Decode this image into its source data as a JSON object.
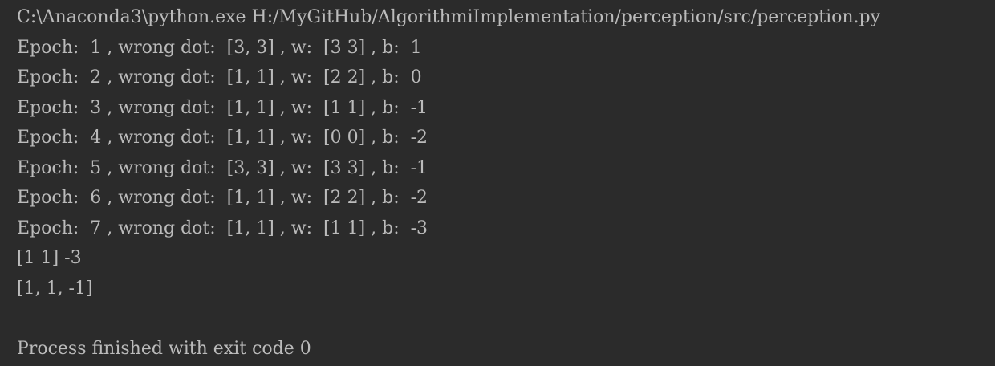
{
  "console": {
    "lines": [
      "C:\\Anaconda3\\python.exe H:/MyGitHub/AlgorithmiImplementation/perception/src/perception.py",
      "Epoch:  1 , wrong dot:  [3, 3] , w:  [3 3] , b:  1",
      "Epoch:  2 , wrong dot:  [1, 1] , w:  [2 2] , b:  0",
      "Epoch:  3 , wrong dot:  [1, 1] , w:  [1 1] , b:  -1",
      "Epoch:  4 , wrong dot:  [1, 1] , w:  [0 0] , b:  -2",
      "Epoch:  5 , wrong dot:  [3, 3] , w:  [3 3] , b:  -1",
      "Epoch:  6 , wrong dot:  [1, 1] , w:  [2 2] , b:  -2",
      "Epoch:  7 , wrong dot:  [1, 1] , w:  [1 1] , b:  -3",
      "[1 1] -3",
      "[1, 1, -1]",
      "",
      "Process finished with exit code 0"
    ]
  }
}
